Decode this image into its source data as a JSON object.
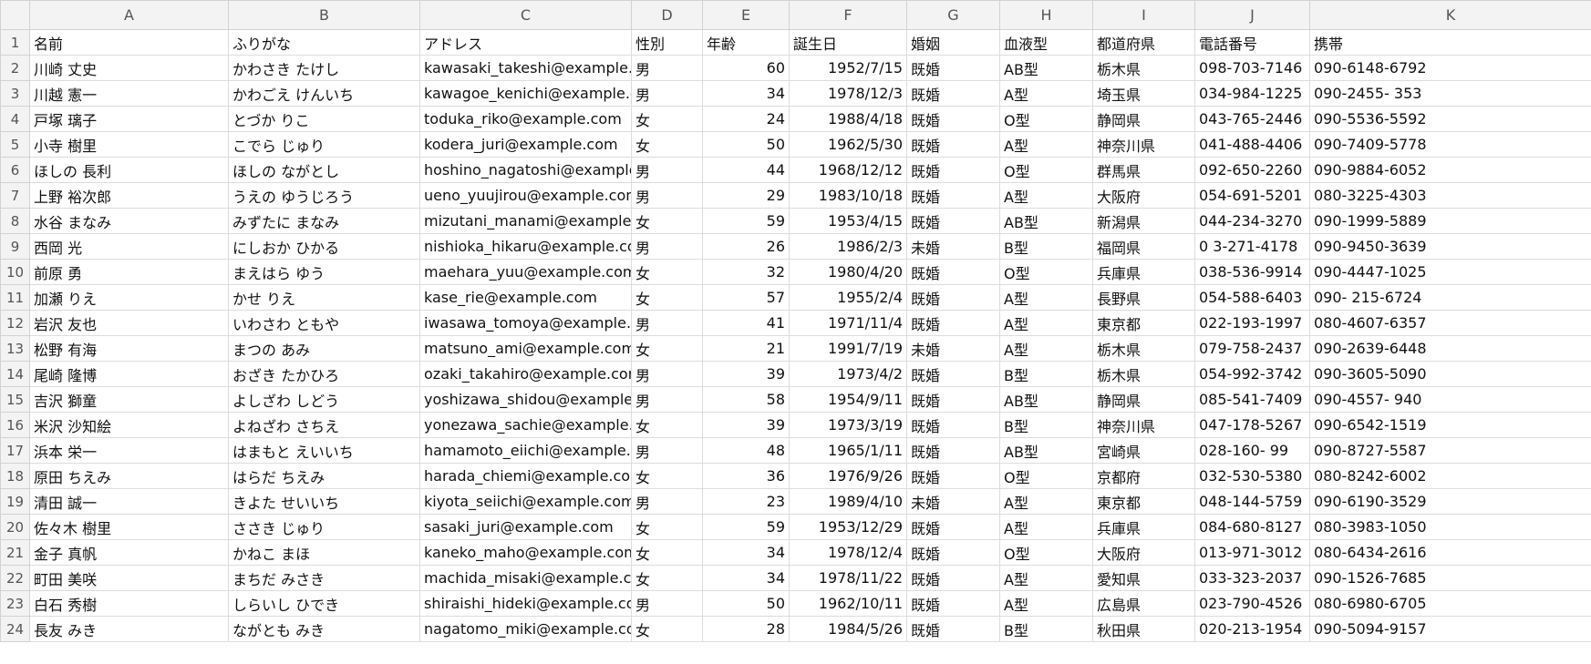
{
  "spreadsheet": {
    "columns": [
      "A",
      "B",
      "C",
      "D",
      "E",
      "F",
      "G",
      "H",
      "I",
      "J",
      "K"
    ],
    "rows": [
      [
        "名前",
        "ふりがな",
        "アドレス",
        "性別",
        "年齢",
        "誕生日",
        "婚姻",
        "血液型",
        "都道府県",
        "電話番号",
        "携帯"
      ],
      [
        "川崎 丈史",
        "かわさき たけし",
        "kawasaki_takeshi@example.co",
        "男",
        "60",
        "1952/7/15",
        "既婚",
        "AB型",
        "栃木県",
        "098-703-7146",
        "090-6148-6792"
      ],
      [
        "川越 憲一",
        "かわごえ けんいち",
        "kawagoe_kenichi@example.co",
        "男",
        "34",
        "1978/12/3",
        "既婚",
        "A型",
        "埼玉県",
        "034-984-1225",
        "090-2455- 353"
      ],
      [
        "戸塚 璃子",
        "とづか りこ",
        "toduka_riko@example.com",
        "女",
        "24",
        "1988/4/18",
        "既婚",
        "O型",
        "静岡県",
        "043-765-2446",
        "090-5536-5592"
      ],
      [
        "小寺 樹里",
        "こでら じゅり",
        "kodera_juri@example.com",
        "女",
        "50",
        "1962/5/30",
        "既婚",
        "A型",
        "神奈川県",
        "041-488-4406",
        "090-7409-5778"
      ],
      [
        "ほしの 長利",
        "ほしの ながとし",
        "hoshino_nagatoshi@example.c",
        "男",
        "44",
        "1968/12/12",
        "既婚",
        "O型",
        "群馬県",
        "092-650-2260",
        "090-9884-6052"
      ],
      [
        "上野 裕次郎",
        "うえの ゆうじろう",
        "ueno_yuujirou@example.com",
        "男",
        "29",
        "1983/10/18",
        "既婚",
        "A型",
        "大阪府",
        "054-691-5201",
        "080-3225-4303"
      ],
      [
        "水谷 まなみ",
        "みずたに まなみ",
        "mizutani_manami@example.co",
        "女",
        "59",
        "1953/4/15",
        "既婚",
        "AB型",
        "新潟県",
        "044-234-3270",
        "090-1999-5889"
      ],
      [
        "西岡 光",
        "にしおか ひかる",
        "nishioka_hikaru@example.com",
        "男",
        "26",
        "1986/2/3",
        "未婚",
        "B型",
        "福岡県",
        "0 3-271-4178",
        "090-9450-3639"
      ],
      [
        "前原 勇",
        "まえはら ゆう",
        "maehara_yuu@example.com",
        "女",
        "32",
        "1980/4/20",
        "既婚",
        "O型",
        "兵庫県",
        "038-536-9914",
        "090-4447-1025"
      ],
      [
        "加瀬 りえ",
        "かせ りえ",
        "kase_rie@example.com",
        "女",
        "57",
        "1955/2/4",
        "既婚",
        "A型",
        "長野県",
        "054-588-6403",
        "090- 215-6724"
      ],
      [
        "岩沢 友也",
        "いわさわ ともや",
        "iwasawa_tomoya@example.co",
        "男",
        "41",
        "1971/11/4",
        "既婚",
        "A型",
        "東京都",
        "022-193-1997",
        "080-4607-6357"
      ],
      [
        "松野 有海",
        "まつの あみ",
        "matsuno_ami@example.com",
        "女",
        "21",
        "1991/7/19",
        "未婚",
        "A型",
        "栃木県",
        "079-758-2437",
        "090-2639-6448"
      ],
      [
        "尾崎 隆博",
        "おざき たかひろ",
        "ozaki_takahiro@example.com",
        "男",
        "39",
        "1973/4/2",
        "既婚",
        "B型",
        "栃木県",
        "054-992-3742",
        "090-3605-5090"
      ],
      [
        "吉沢 獅童",
        "よしざわ しどう",
        "yoshizawa_shidou@example.c",
        "男",
        "58",
        "1954/9/11",
        "既婚",
        "AB型",
        "静岡県",
        "085-541-7409",
        "090-4557- 940"
      ],
      [
        "米沢 沙知絵",
        "よねざわ さちえ",
        "yonezawa_sachie@example.co",
        "女",
        "39",
        "1973/3/19",
        "既婚",
        "B型",
        "神奈川県",
        "047-178-5267",
        "090-6542-1519"
      ],
      [
        "浜本 栄一",
        "はまもと えいいち",
        "hamamoto_eiichi@example.co",
        "男",
        "48",
        "1965/1/11",
        "既婚",
        "AB型",
        "宮崎県",
        "028-160-  99",
        "090-8727-5587"
      ],
      [
        "原田 ちえみ",
        "はらだ ちえみ",
        "harada_chiemi@example.com",
        "女",
        "36",
        "1976/9/26",
        "既婚",
        "O型",
        "京都府",
        "032-530-5380",
        "080-8242-6002"
      ],
      [
        "清田 誠一",
        "きよた せいいち",
        "kiyota_seiichi@example.com",
        "男",
        "23",
        "1989/4/10",
        "未婚",
        "A型",
        "東京都",
        "048-144-5759",
        "090-6190-3529"
      ],
      [
        "佐々木 樹里",
        "ささき じゅり",
        "sasaki_juri@example.com",
        "女",
        "59",
        "1953/12/29",
        "既婚",
        "A型",
        "兵庫県",
        "084-680-8127",
        "080-3983-1050"
      ],
      [
        "金子 真帆",
        "かねこ まほ",
        "kaneko_maho@example.com",
        "女",
        "34",
        "1978/12/4",
        "既婚",
        "O型",
        "大阪府",
        "013-971-3012",
        "080-6434-2616"
      ],
      [
        "町田 美咲",
        "まちだ みさき",
        "machida_misaki@example.con",
        "女",
        "34",
        "1978/11/22",
        "既婚",
        "A型",
        "愛知県",
        "033-323-2037",
        "090-1526-7685"
      ],
      [
        "白石 秀樹",
        "しらいし ひでき",
        "shiraishi_hideki@example.com",
        "男",
        "50",
        "1962/10/11",
        "既婚",
        "A型",
        "広島県",
        "023-790-4526",
        "080-6980-6705"
      ],
      [
        "長友 みき",
        "ながとも みき",
        "nagatomo_miki@example.com",
        "女",
        "28",
        "1984/5/26",
        "既婚",
        "B型",
        "秋田県",
        "020-213-1954",
        "090-5094-9157"
      ]
    ]
  }
}
